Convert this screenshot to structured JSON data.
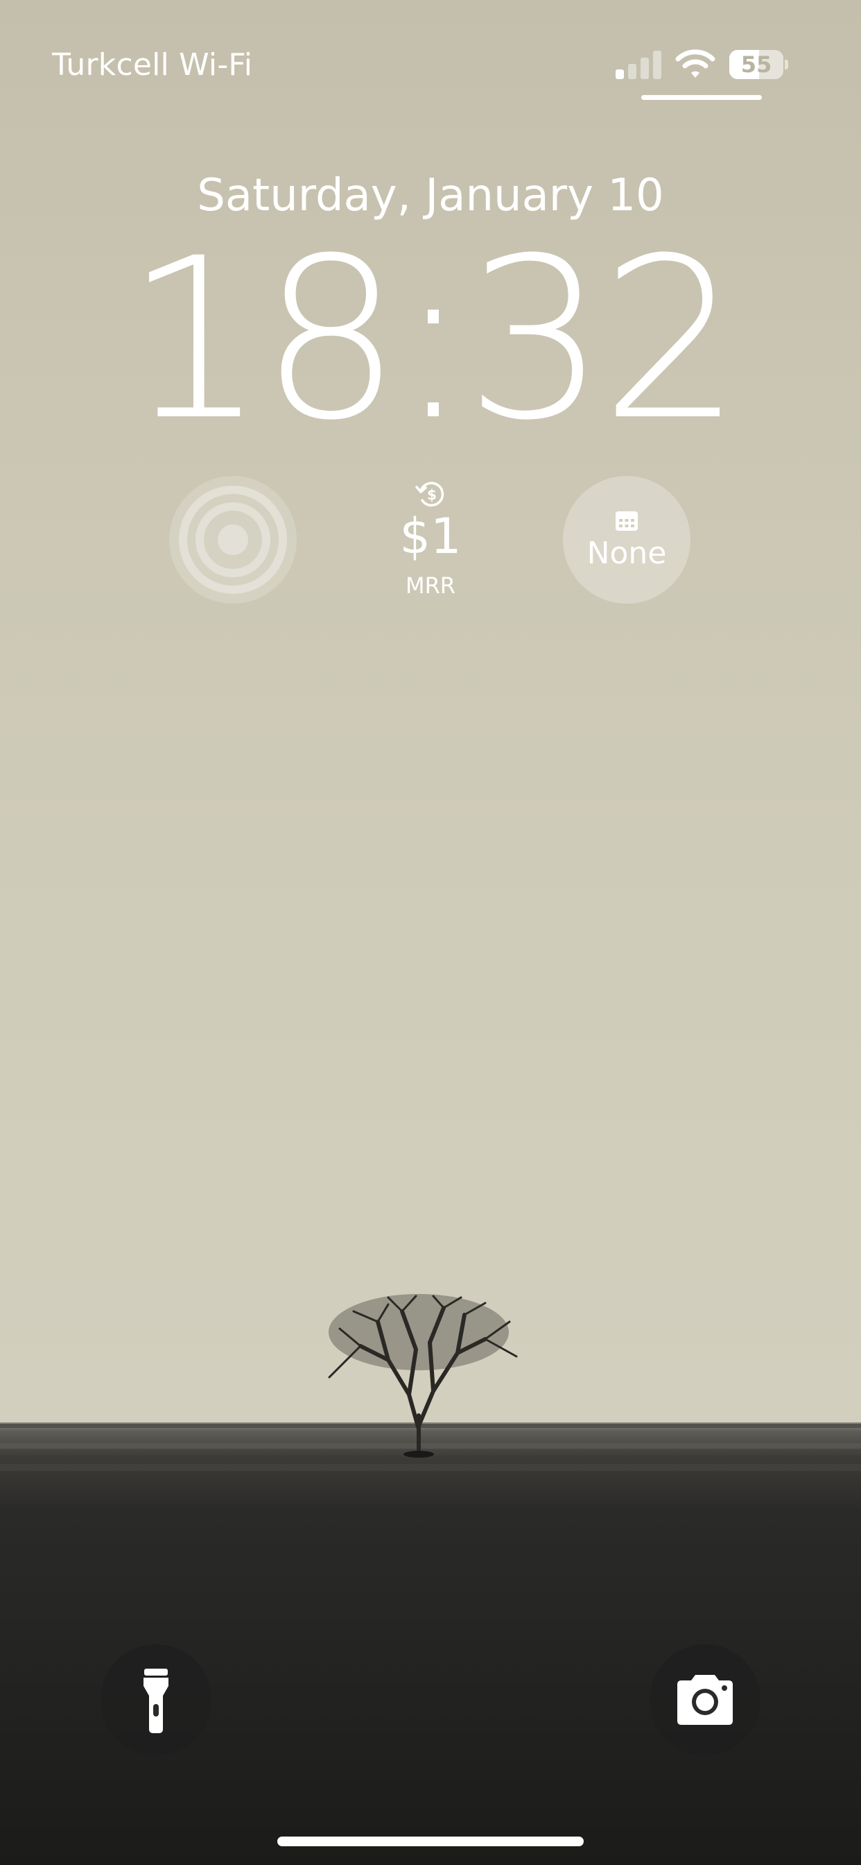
{
  "status_bar": {
    "carrier": "Turkcell Wi-Fi",
    "signal_bars_active": 1,
    "signal_bars_total": 4,
    "wifi_icon": "wifi-icon",
    "battery_percent": "55",
    "battery_level": 0.55
  },
  "lock_screen": {
    "date": "Saturday, January 10",
    "time": "18:32"
  },
  "widgets": {
    "rings": {
      "icon": "activity-rings-icon"
    },
    "mrr": {
      "icon": "dollar-refresh-icon",
      "value": "$1",
      "label": "MRR"
    },
    "calendar": {
      "icon": "calendar-icon",
      "label": "None"
    }
  },
  "quick_actions": {
    "left": {
      "icon": "flashlight-icon"
    },
    "right": {
      "icon": "camera-icon"
    }
  },
  "colors": {
    "sky": "#cfcbb9",
    "ground": "#1f1f1d",
    "text": "#ffffff"
  }
}
